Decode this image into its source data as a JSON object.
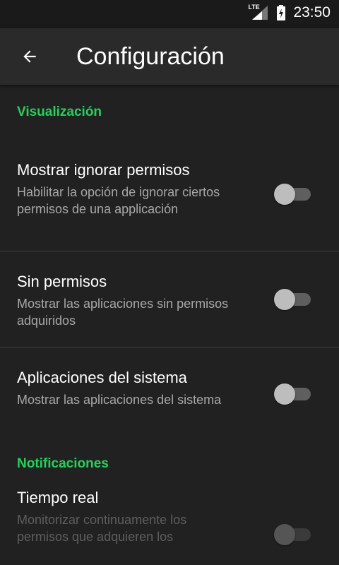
{
  "status_bar": {
    "network": "LTE",
    "time": "23:50"
  },
  "app_bar": {
    "title": "Configuración"
  },
  "sections": [
    {
      "header": "Visualización",
      "items": [
        {
          "title": "Mostrar ignorar permisos",
          "summary": "Habilitar la opción de ignorar ciertos permisos de una applicación",
          "checked": false
        },
        {
          "title": "Sin permisos",
          "summary": "Mostrar las aplicaciones sin permisos adquiridos",
          "checked": false
        },
        {
          "title": "Aplicaciones del sistema",
          "summary": "Mostrar las aplicaciones del sistema",
          "checked": false
        }
      ]
    },
    {
      "header": "Notificaciones",
      "items": [
        {
          "title": "Tiempo real",
          "summary": "Monitorizar continuamente los permisos que adquieren los",
          "checked": false
        }
      ]
    }
  ]
}
